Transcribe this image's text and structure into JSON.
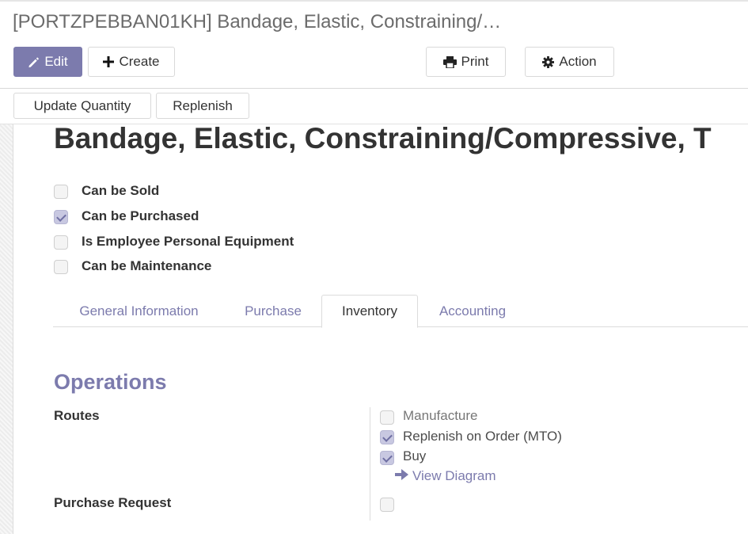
{
  "header": {
    "title": "[PORTZPEBBAN01KH] Bandage, Elastic, Constraining/…"
  },
  "toolbar": {
    "edit_label": "Edit",
    "create_label": "Create",
    "print_label": "Print",
    "action_label": "Action",
    "edit_icon": "pencil-icon",
    "create_icon": "plus-icon",
    "print_icon": "printer-icon",
    "action_icon": "gear-icon"
  },
  "statusbar": {
    "update_quantity_label": "Update Quantity",
    "replenish_label": "Replenish"
  },
  "product": {
    "name": "Bandage, Elastic, Constraining/Compressive, T",
    "flags": [
      {
        "label": "Can be Sold",
        "checked": false
      },
      {
        "label": "Can be Purchased",
        "checked": true
      },
      {
        "label": "Is Employee Personal Equipment",
        "checked": false
      },
      {
        "label": "Can be Maintenance",
        "checked": false
      }
    ]
  },
  "tabs": [
    {
      "label": "General Information",
      "active": false
    },
    {
      "label": "Purchase",
      "active": false
    },
    {
      "label": "Inventory",
      "active": true
    },
    {
      "label": "Accounting",
      "active": false
    }
  ],
  "operations": {
    "title": "Operations",
    "routes_label": "Routes",
    "routes": [
      {
        "label": "Manufacture",
        "checked": false,
        "muted": true
      },
      {
        "label": "Replenish on Order (MTO)",
        "checked": true,
        "muted": false
      },
      {
        "label": "Buy",
        "checked": true,
        "muted": false
      }
    ],
    "view_diagram_label": "View Diagram",
    "view_diagram_icon": "arrow-right-icon",
    "purchase_request_label": "Purchase Request",
    "purchase_request_checked": false
  },
  "colors": {
    "accent": "#7c7bad",
    "text_dark": "#333333",
    "border": "#d9d9d9"
  }
}
